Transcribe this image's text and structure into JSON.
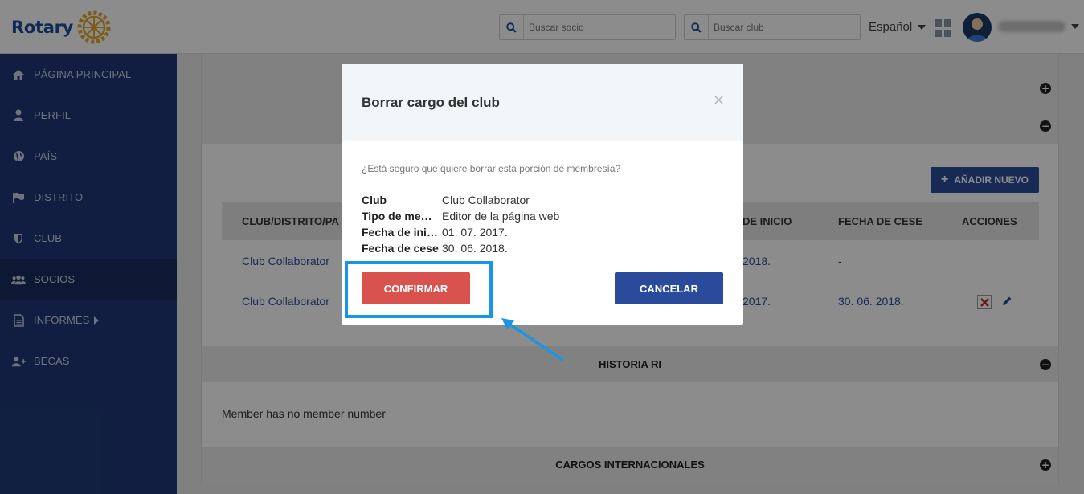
{
  "header": {
    "logo_text": "Rotary",
    "search_member_placeholder": "Buscar socio",
    "search_club_placeholder": "Buscar club",
    "language": "Español"
  },
  "sidebar": {
    "items": [
      {
        "label": "PÁGINA PRINCIPAL",
        "icon": "home-icon"
      },
      {
        "label": "PERFIL",
        "icon": "user-icon"
      },
      {
        "label": "PAÍS",
        "icon": "globe-icon"
      },
      {
        "label": "DISTRITO",
        "icon": "flag-icon"
      },
      {
        "label": "CLUB",
        "icon": "shield-icon"
      },
      {
        "label": "SOCIOS",
        "icon": "users-icon",
        "active": true
      },
      {
        "label": "INFORMES",
        "icon": "document-icon"
      },
      {
        "label": "BECAS",
        "icon": "user-plus-icon"
      }
    ]
  },
  "main": {
    "add_new_label": "AÑADIR NUEVO",
    "table": {
      "headers": [
        "CLUB/DISTRITO/PA",
        "DE INICIO",
        "FECHA DE CESE",
        "ACCIONES"
      ],
      "rows": [
        {
          "club": "Club Collaborator",
          "start": "2018.",
          "end": "-"
        },
        {
          "club": "Club Collaborator",
          "start": "2017.",
          "end": "30. 06. 2018."
        }
      ]
    },
    "historia_title": "HISTORIA RI",
    "member_note": "Member has no member number",
    "cargos_title": "CARGOS INTERNACIONALES"
  },
  "modal": {
    "title": "Borrar cargo del club",
    "close": "×",
    "question": "¿Está seguro que quiere borrar esta porción de membresía?",
    "fields": [
      {
        "label": "Club",
        "value": "Club Collaborator"
      },
      {
        "label": "Tipo de memb…",
        "value": "Editor de la página web"
      },
      {
        "label": "Fecha de inicio",
        "value": "01. 07. 2017."
      },
      {
        "label": "Fecha de cese",
        "value": "30. 06. 2018."
      }
    ],
    "confirm_label": "CONFIRMAR",
    "cancel_label": "CANCELAR"
  },
  "colors": {
    "sidebar_bg": "#1f3877",
    "brand_blue": "#2a4b9b",
    "confirm_red": "#d9524e",
    "highlight_blue": "#1a95e6"
  }
}
